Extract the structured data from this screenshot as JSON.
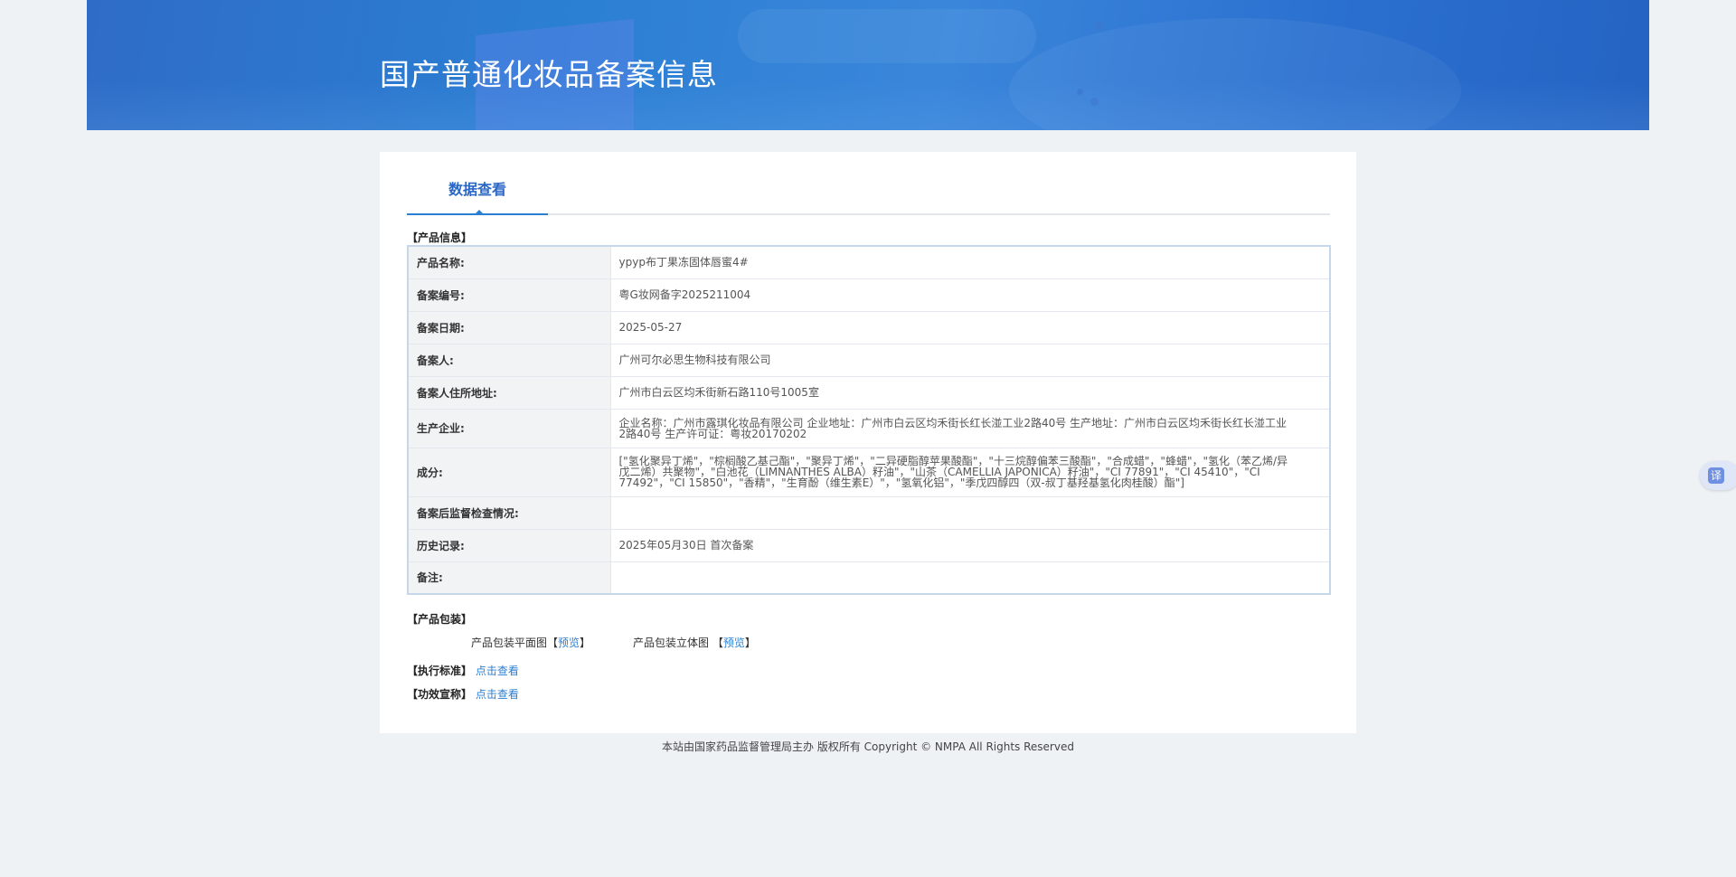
{
  "header": {
    "title": "国产普通化妆品备案信息"
  },
  "tabs": [
    {
      "label": "数据查看"
    }
  ],
  "product_info": {
    "section_title": "【产品信息】",
    "rows": [
      {
        "label": "产品名称:",
        "value": "ypyp布丁果冻固体唇蜜4#"
      },
      {
        "label": "备案编号:",
        "value": "粤G妆网备字2025211004"
      },
      {
        "label": "备案日期:",
        "value": "2025-05-27"
      },
      {
        "label": "备案人:",
        "value": "广州可尔必思生物科技有限公司"
      },
      {
        "label": "备案人住所地址:",
        "value": "广州市白云区均禾街新石路110号1005室"
      },
      {
        "label": "生产企业:",
        "value": "企业名称：广州市露琪化妆品有限公司 企业地址：广州市白云区均禾街长红长湴工业2路40号 生产地址：广州市白云区均禾街长红长湴工业2路40号 生产许可证：粤妆20170202"
      },
      {
        "label": "成分:",
        "value": "[\"氢化聚异丁烯\"，\"棕榈酸乙基己酯\"，\"聚异丁烯\"，\"二异硬脂醇苹果酸酯\"，\"十三烷醇偏苯三酸酯\"，\"合成蜡\"，\"蜂蜡\"，\"氢化（苯乙烯/异戊二烯）共聚物\"，\"白池花（LIMNANTHES ALBA）籽油\"，\"山茶（CAMELLIA JAPONICA）籽油\"，\"CI 77891\"，\"CI 45410\"，\"CI 77492\"，\"CI 15850\"，\"香精\"，\"生育酚（维生素E）\"，\"氢氧化铝\"，\"季戊四醇四（双-叔丁基羟基氢化肉桂酸）酯\"]"
      },
      {
        "label": "备案后监督检查情况:",
        "value": ""
      },
      {
        "label": "历史记录:",
        "value": "2025年05月30日 首次备案"
      },
      {
        "label": "备注:",
        "value": ""
      }
    ]
  },
  "packaging": {
    "section_title": "【产品包装】",
    "flat_label": "产品包装平面图",
    "flat_link": "预览",
    "solid_label": "产品包装立体图",
    "solid_link": "预览",
    "bracket_open": "【",
    "bracket_close": "】"
  },
  "standard": {
    "label": "【执行标准】",
    "link": "点击查看"
  },
  "efficacy": {
    "label": "【功效宣称】",
    "link": "点击查看"
  },
  "footer": {
    "text": "本站由国家药品监督管理局主办 版权所有 Copyright © NMPA All Rights Reserved"
  },
  "translate_button": {
    "glyph": "译"
  }
}
